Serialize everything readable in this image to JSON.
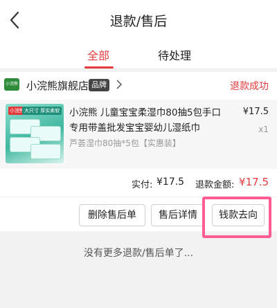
{
  "header": {
    "title": "退款/售后"
  },
  "tabs": [
    {
      "label": "全部",
      "active": true
    },
    {
      "label": "待处理",
      "active": false
    }
  ],
  "shop": {
    "logo_text": "小浣熊",
    "name": "小浣熊旗舰店",
    "badge": "品牌",
    "status": "退款成功"
  },
  "product": {
    "name": "小浣熊 儿童宝宝柔湿巾80抽5包手口专用带盖批发宝宝婴幼儿湿纸巾",
    "spec": "芦荟湿巾80抽*5包【实惠装】",
    "price": "¥17.5",
    "quantity": "x1",
    "thumb_brand": "小浣熊",
    "thumb_tag": "大尺寸 厚实柔软"
  },
  "totals": {
    "paid_label": "实付:",
    "paid_value": "¥17.5",
    "refund_label": "退款金额:",
    "refund_value": "¥17.5"
  },
  "actions": {
    "delete": "删除售后单",
    "details": "售后详情",
    "refund_destination": "钱款去向"
  },
  "footer": {
    "text": "没有更多退款/售后单了..."
  },
  "colors": {
    "accent": "#e4393c",
    "highlight": "#ff5b95"
  }
}
